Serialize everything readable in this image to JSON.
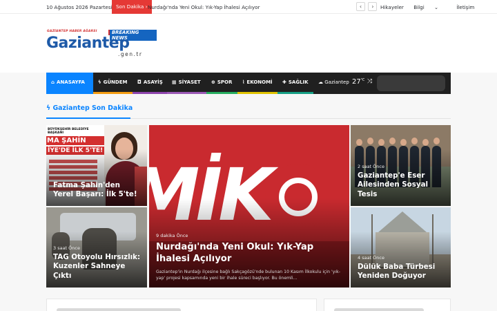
{
  "topbar": {
    "date": "10 Ağustos 2026 Pazartesi",
    "breaking_label": "Son Dakika",
    "breaking_arrow": "›",
    "ticker_text": "Nurdağı'nda Yeni Okul: Yık-Yap İhalesi Açılıyor",
    "prev_icon": "‹",
    "next_icon": "›",
    "links": [
      "Hikayeler",
      "Bilgi",
      "İletişim"
    ],
    "bilgi_chevron": "⌄"
  },
  "logo": {
    "tagline": "GAZİANTEP HABER AĞARSI",
    "badge": "BREAKING NEWS",
    "name": "Gaziantep",
    "domain": ".gen.tr"
  },
  "nav": {
    "items": [
      {
        "label": "ANASAYFA",
        "icon": "home-icon",
        "color": "#0a84ff"
      },
      {
        "label": "GÜNDEM",
        "icon": "bolt-icon",
        "color": "#f39c12"
      },
      {
        "label": "ASAYİŞ",
        "icon": "car-icon",
        "color": "#8e44ad"
      },
      {
        "label": "SİYASET",
        "icon": "building-icon",
        "color": "#9b59b6"
      },
      {
        "label": "SPOR",
        "icon": "ball-icon",
        "color": "#27ae60"
      },
      {
        "label": "EKONOMİ",
        "icon": "chart-icon",
        "color": "#e0c300"
      },
      {
        "label": "SAĞLIK",
        "icon": "plus-icon",
        "color": "#16a085"
      }
    ],
    "weather_city": "Gaziantep",
    "weather_temp": "27",
    "weather_unit": "℃",
    "search_placeholder": ""
  },
  "section": {
    "title": "Gaziantep Son Dakika",
    "accent": "#0a84ff"
  },
  "cards": {
    "c1": {
      "title": "Fatma Şahin'den Yerel Başarı: İlk 5'te!",
      "poster_head": "BÜYÜKŞEHİR BELEDİYE BAŞKANI",
      "poster_name": "MA ŞAHİN",
      "poster_rank": "İYE'DE İLK 5'TE!"
    },
    "c2": {
      "meta": "9 dakika Önce",
      "title": "Nurdağı'nda Yeni Okul: Yık-Yap İhalesi Açılıyor",
      "excerpt": "Gaziantep'in Nurdağı ilçesine bağlı Sakçagözü'nde bulunan 10 Kasım İlkokulu için 'yık-yap' projesi kapsamında yeni bir ihale süreci başlıyor. Bu önemli...",
      "logo_text": "MİKO"
    },
    "c3": {
      "meta": "2 saat Önce",
      "title": "Gaziantep'e Eser Ailesinden Sosyal Tesis"
    },
    "c4": {
      "meta": "3 saat Önce",
      "title": "TAG Otoyolu Hırsızlık: Kuzenler Sahneye Çıktı"
    },
    "c5": {
      "meta": "4 saat Önce",
      "title": "Dülük Baba Türbesi Yeniden Doğuyor"
    }
  }
}
